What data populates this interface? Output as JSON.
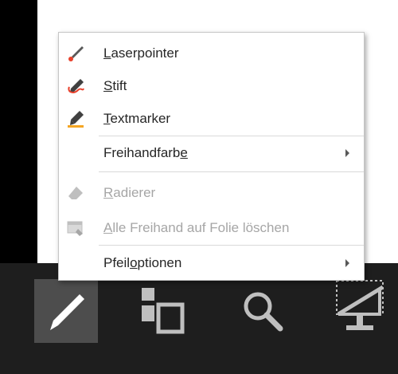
{
  "menu": {
    "items": [
      {
        "pre": "",
        "key": "L",
        "post": "aserpointer",
        "icon": "laser-pointer-icon",
        "disabled": false,
        "submenu": false
      },
      {
        "pre": "",
        "key": "S",
        "post": "tift",
        "icon": "pen-icon",
        "disabled": false,
        "submenu": false
      },
      {
        "pre": "",
        "key": "T",
        "post": "extmarker",
        "icon": "highlighter-icon",
        "disabled": false,
        "submenu": false
      },
      {
        "pre": "Freihandfarb",
        "key": "e",
        "post": "",
        "icon": "",
        "disabled": false,
        "submenu": true
      },
      {
        "pre": "",
        "key": "R",
        "post": "adierer",
        "icon": "eraser-icon",
        "disabled": true,
        "submenu": false
      },
      {
        "pre": "",
        "key": "A",
        "post": "lle Freihand auf Folie löschen",
        "icon": "erase-all-ink-icon",
        "disabled": true,
        "submenu": false
      },
      {
        "pre": "Pfeil",
        "key": "o",
        "post": "ptionen",
        "icon": "",
        "disabled": false,
        "submenu": true
      }
    ]
  },
  "toolbar": {
    "buttons": [
      {
        "name": "pen-tool-button",
        "icon": "pen-icon",
        "active": true
      },
      {
        "name": "see-all-slides-button",
        "icon": "slides-grid-icon",
        "active": false
      },
      {
        "name": "zoom-button",
        "icon": "magnifier-icon",
        "active": false
      },
      {
        "name": "screen-blank-button",
        "icon": "screen-off-icon",
        "active": false
      }
    ]
  },
  "colors": {
    "menu_text": "#262626",
    "disabled_text": "#a6a6a6",
    "laser_red": "#e8412c",
    "highlighter_orange": "#f5a623",
    "toolbar_bg": "#1e1e1e",
    "active_button_bg": "#4d4d4d"
  }
}
